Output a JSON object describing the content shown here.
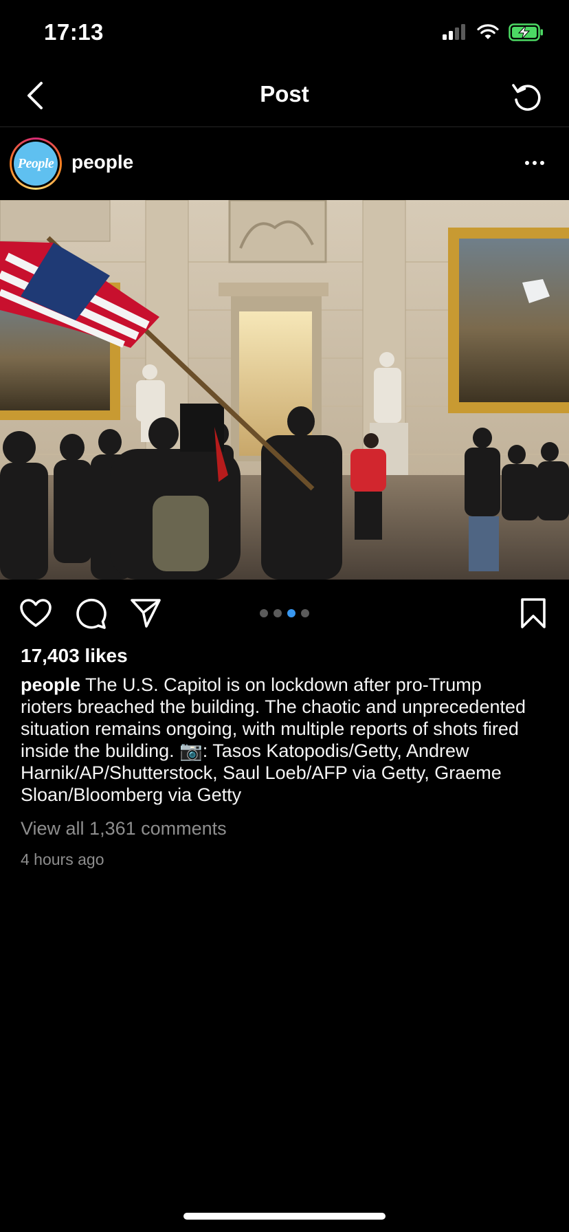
{
  "status_bar": {
    "time": "17:13",
    "icons": [
      "signal-icon",
      "wifi-icon",
      "battery-charging-icon"
    ],
    "battery_color": "#4cd964"
  },
  "nav": {
    "title": "Post",
    "back_icon": "chevron-left-icon",
    "refresh_icon": "refresh-icon"
  },
  "post": {
    "username": "people",
    "avatar_text": "People",
    "avatar_color": "#5fc0f0",
    "more_icon": "more-horizontal-icon",
    "photo_alt": "Photo in the U.S. Capitol Rotunda",
    "carousel": {
      "count": 4,
      "active_index": 2,
      "active_color": "#3897f0"
    },
    "actions": [
      "heart-icon",
      "comment-icon",
      "share-icon",
      "bookmark-icon"
    ],
    "likes": "17,403 likes",
    "caption_user": "people",
    "caption_text": " The U.S. Capitol is on lockdown after pro-Trump rioters breached the building. The chaotic and unprecedented situation remains ongoing, with multiple reports of shots fired inside the building. 📷: Tasos Katopodis/Getty, Andrew Harnik/AP/Shutterstock, Saul Loeb/AFP via Getty, Graeme Sloan/Bloomberg via Getty",
    "view_comments": "View all 1,361 comments",
    "timestamp": "4 hours ago"
  }
}
